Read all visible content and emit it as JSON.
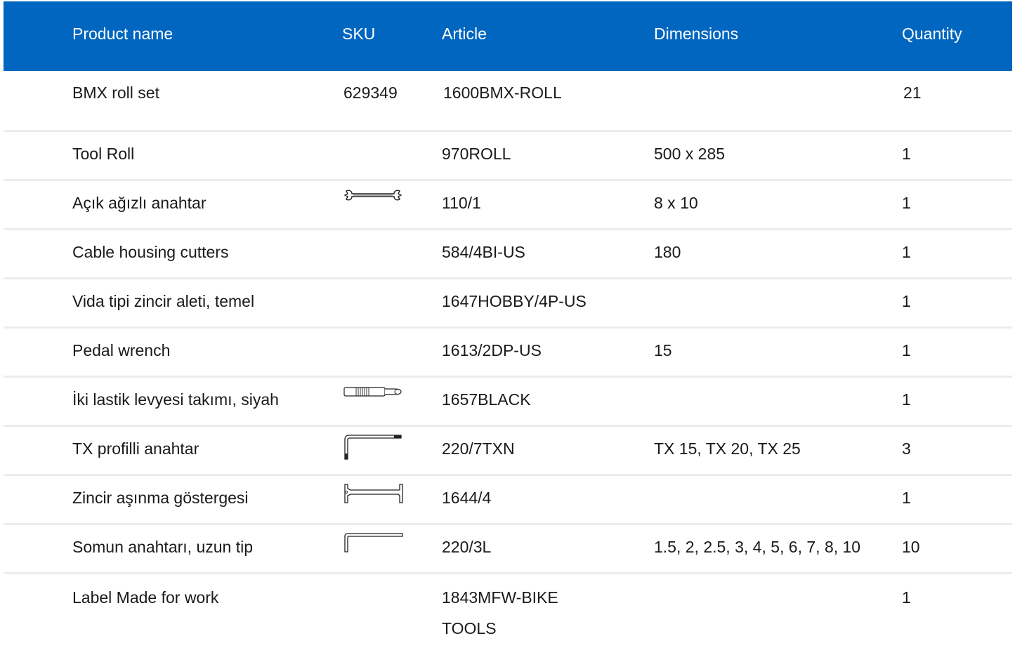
{
  "header": {
    "product_name": "Product name",
    "sku": "SKU",
    "article": "Article",
    "dimensions": "Dimensions",
    "quantity": "Quantity"
  },
  "rows": [
    {
      "name": "BMX roll set",
      "sku": "629349",
      "icon": "",
      "article": "1600BMX-ROLL",
      "dimensions": "",
      "quantity": "21"
    },
    {
      "name": "Tool Roll",
      "sku": "",
      "icon": "",
      "article": "970ROLL",
      "dimensions": "500 x 285",
      "quantity": "1"
    },
    {
      "name": "Açık ağızlı anahtar",
      "sku": "",
      "icon": "open-end-wrench-icon",
      "article": "110/1",
      "dimensions": "8 x 10",
      "quantity": "1"
    },
    {
      "name": "Cable housing cutters",
      "sku": "",
      "icon": "",
      "article": "584/4BI-US",
      "dimensions": "180",
      "quantity": "1"
    },
    {
      "name": "Vida tipi zincir aleti, temel",
      "sku": "",
      "icon": "",
      "article": "1647HOBBY/4P-US",
      "dimensions": "",
      "quantity": "1"
    },
    {
      "name": "Pedal wrench",
      "sku": "",
      "icon": "",
      "article": "1613/2DP-US",
      "dimensions": "15",
      "quantity": "1"
    },
    {
      "name": "İki lastik levyesi takımı, siyah",
      "sku": "",
      "icon": "tire-lever-icon",
      "article": "1657BLACK",
      "dimensions": "",
      "quantity": "1"
    },
    {
      "name": "TX profilli anahtar",
      "sku": "",
      "icon": "torx-key-icon",
      "article": "220/7TXN",
      "dimensions": "TX 15, TX 20, TX 25",
      "quantity": "3"
    },
    {
      "name": "Zincir aşınma göstergesi",
      "sku": "",
      "icon": "chain-wear-gauge-icon",
      "article": "1644/4",
      "dimensions": "",
      "quantity": "1"
    },
    {
      "name": "Somun anahtarı, uzun tip",
      "sku": "",
      "icon": "hex-key-icon",
      "article": "220/3L",
      "dimensions": "1.5, 2, 2.5, 3, 4, 5, 6, 7, 8, 10",
      "quantity": "10"
    },
    {
      "name": "Label Made for work",
      "sku": "",
      "icon": "",
      "article": "1843MFW-BIKE TOOLS",
      "dimensions": "",
      "quantity": "1"
    }
  ]
}
